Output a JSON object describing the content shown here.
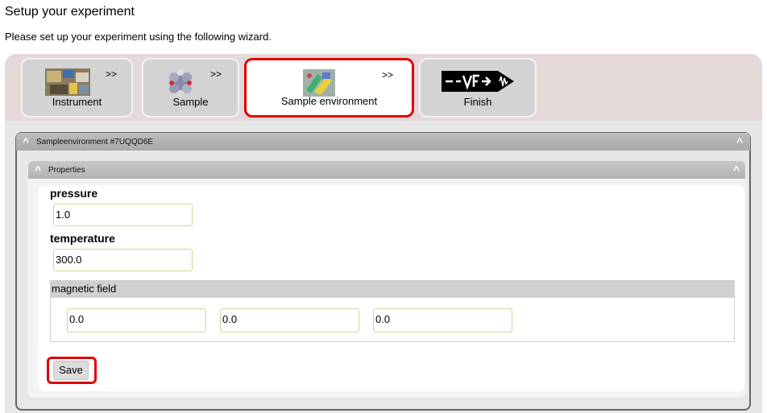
{
  "page": {
    "title": "Setup your experiment",
    "subtitle": "Please set up your experiment using the following wizard."
  },
  "wizard": {
    "steps": [
      {
        "label": "Instrument",
        "next": ">>",
        "icon": "instrument-image",
        "active": false
      },
      {
        "label": "Sample",
        "next": ">>",
        "icon": "molecule-image",
        "active": false
      },
      {
        "label": "Sample environment",
        "next": ">>",
        "icon": "sample-environment-image",
        "active": true
      },
      {
        "label": "Finish",
        "next": "",
        "icon": "finish-logo",
        "active": false
      }
    ]
  },
  "section": {
    "caret": "^",
    "title": "Sampleenvironment #7UQQD6E"
  },
  "properties": {
    "caret": "^",
    "title": "Properties",
    "pressure_label": "pressure",
    "pressure_value": "1.0",
    "temperature_label": "temperature",
    "temperature_value": "300.0",
    "magnetic_field_label": "magnetic field",
    "magnetic_field_values": [
      "0.0",
      "0.0",
      "0.0"
    ],
    "save_label": "Save"
  },
  "colors": {
    "highlight": "#e00000",
    "wizard_bar": "#e4d9d9",
    "step_bg": "#d3d3d3",
    "input_border": "#c9d89c"
  }
}
